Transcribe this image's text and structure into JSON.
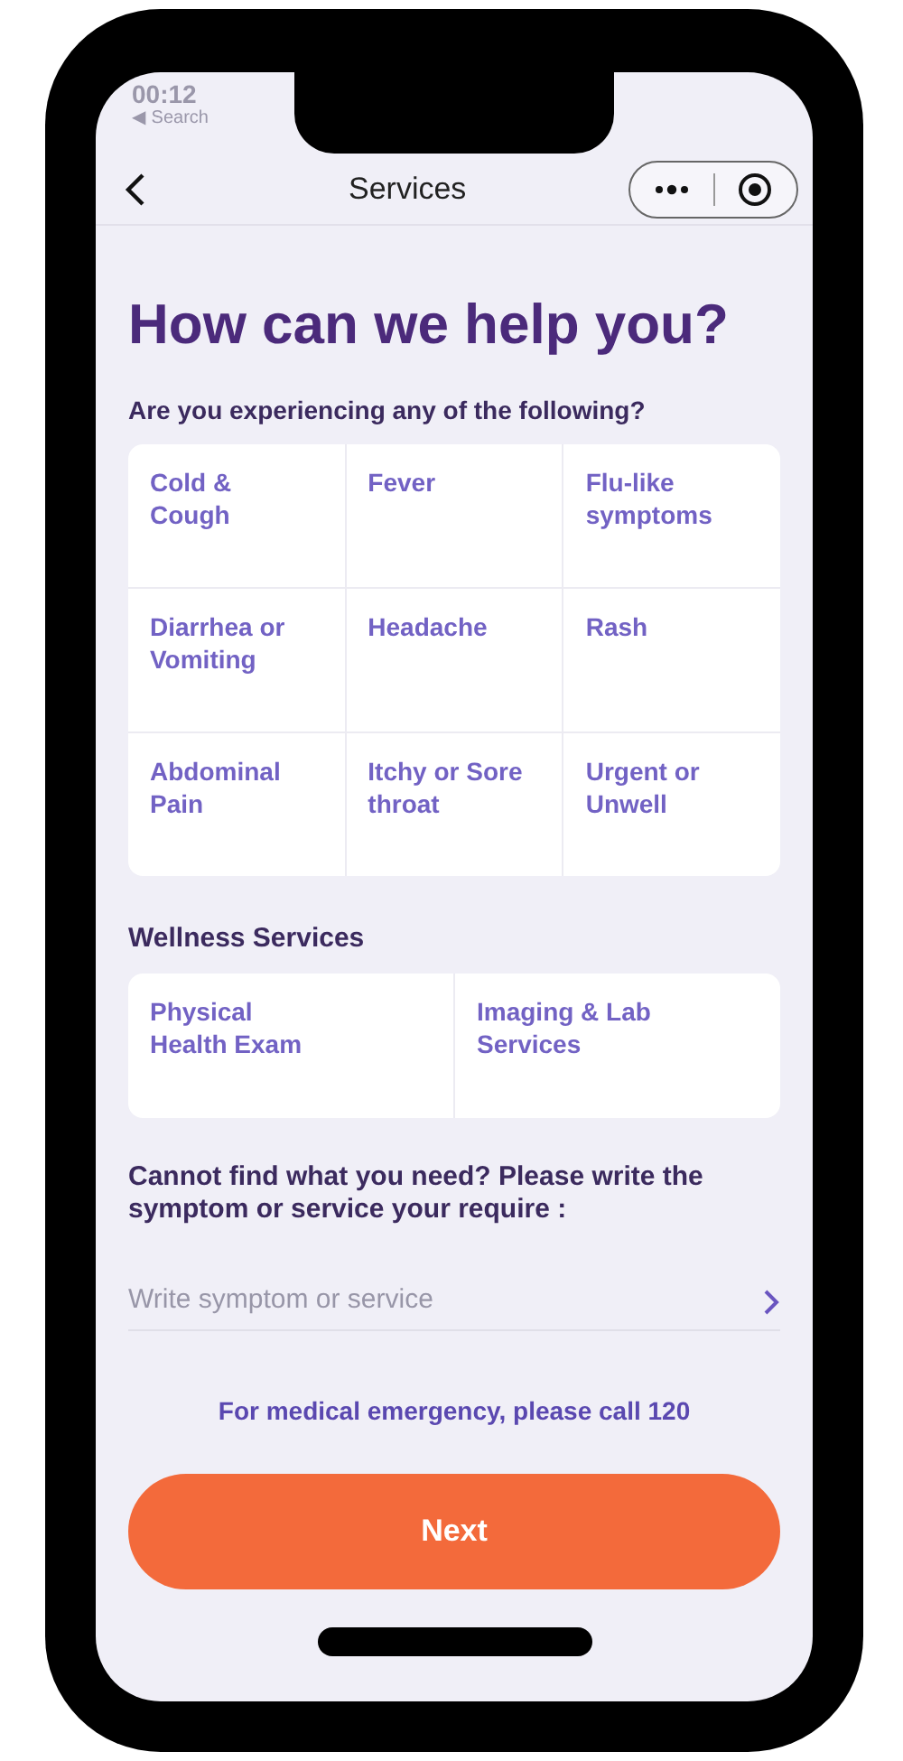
{
  "status_bar": {
    "time": "00:12",
    "back_label": "◀ Search"
  },
  "nav": {
    "title": "Services"
  },
  "heading": "How can we help you?",
  "symptoms": {
    "title": "Are you experiencing any of the following?",
    "items": [
      {
        "label": "Cold &\nCough"
      },
      {
        "label": "Fever"
      },
      {
        "label": "Flu-like symptoms"
      },
      {
        "label": "Diarrhea or Vomiting"
      },
      {
        "label": "Headache"
      },
      {
        "label": "Rash"
      },
      {
        "label": "Abdominal Pain"
      },
      {
        "label": "Itchy or Sore throat"
      },
      {
        "label": "Urgent or Unwell"
      }
    ]
  },
  "wellness": {
    "title": "Wellness Services",
    "items": [
      {
        "label": "Physical\nHealth Exam"
      },
      {
        "label": "Imaging & Lab Services"
      }
    ]
  },
  "custom": {
    "prompt": "Cannot find what you need? Please write the symptom or service your require :",
    "placeholder": "Write symptom or service"
  },
  "emergency_note": "For medical emergency, please call 120",
  "next_button": "Next"
}
